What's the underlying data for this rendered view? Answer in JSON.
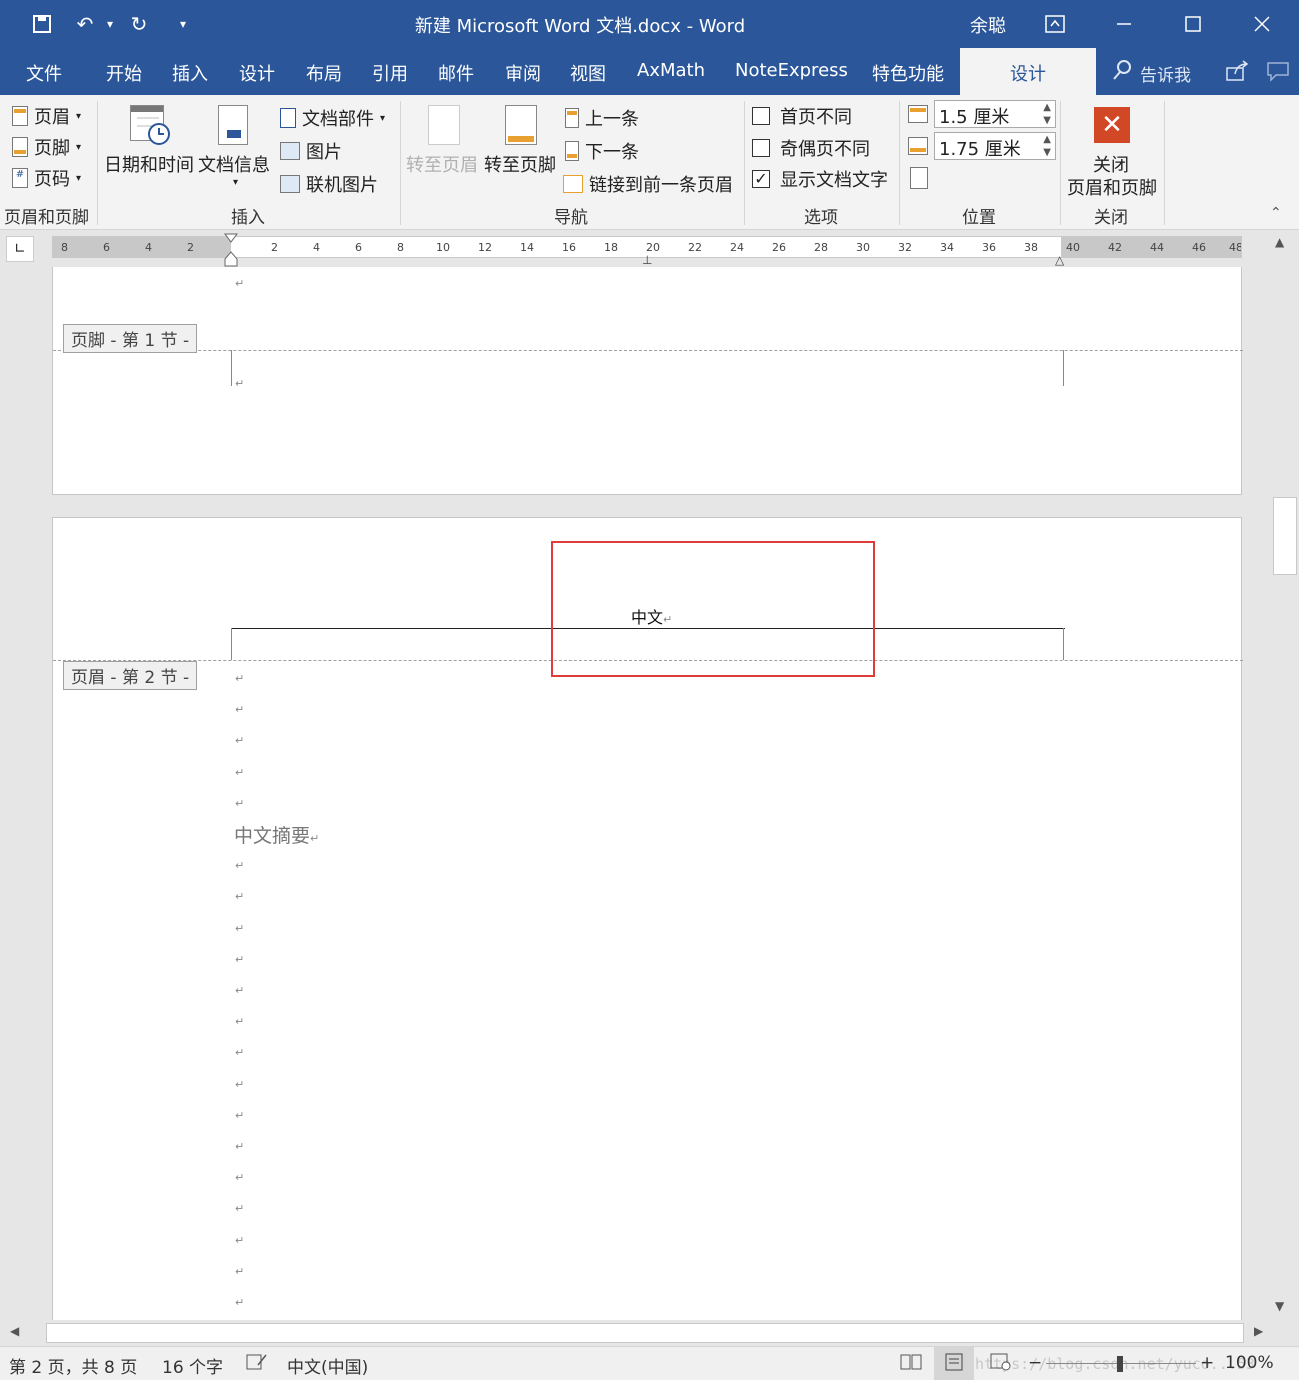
{
  "titlebar": {
    "title": "新建 Microsoft Word 文档.docx  -  Word",
    "user": "余聪",
    "qa_icons": [
      "save-icon",
      "undo-icon",
      "redo-icon",
      "customize-icon"
    ]
  },
  "tabs": {
    "items": [
      "文件",
      "开始",
      "插入",
      "设计",
      "布局",
      "引用",
      "邮件",
      "审阅",
      "视图",
      "AxMath",
      "NoteExpress",
      "特色功能"
    ],
    "active": "设计",
    "tell_me": "告诉我"
  },
  "ribbon": {
    "hf_group": {
      "header": "页眉",
      "footer": "页脚",
      "page_number": "页码",
      "label": "页眉和页脚"
    },
    "insert_group": {
      "datetime": "日期和时间",
      "docinfo": "文档信息",
      "quickparts": "文档部件",
      "picture": "图片",
      "online_picture": "联机图片",
      "label": "插入"
    },
    "nav_group": {
      "goto_header": "转至页眉",
      "goto_footer": "转至页脚",
      "previous": "上一条",
      "next": "下一条",
      "link_previous": "链接到前一条页眉",
      "label": "导航"
    },
    "options_group": {
      "diff_first": "首页不同",
      "diff_odd_even": "奇偶页不同",
      "show_doc_text": "显示文档文字",
      "label": "选项"
    },
    "position_group": {
      "header_from_top": "1.5 厘米",
      "footer_from_bottom": "1.75 厘米",
      "label": "位置"
    },
    "close_group": {
      "close_line1": "关闭",
      "close_line2": "页眉和页脚",
      "label": "关闭"
    }
  },
  "ruler": {
    "left_ticks": [
      "8",
      "6",
      "4",
      "2"
    ],
    "right_ticks": [
      "2",
      "4",
      "6",
      "8",
      "10",
      "12",
      "14",
      "16",
      "18",
      "20",
      "22",
      "24",
      "26",
      "28",
      "30",
      "32",
      "34",
      "36",
      "38",
      "40",
      "42",
      "44",
      "46",
      "48"
    ]
  },
  "page1": {
    "footer_label": "页脚 - 第 1 节 -"
  },
  "page2": {
    "header_label": "页眉 - 第 2 节 -",
    "header_text": "中文",
    "abstract_heading": "中文摘要"
  },
  "statusbar": {
    "page_info": "第 2 页，共 8 页",
    "word_count": "16 个字",
    "language": "中文(中国)",
    "zoom": "100%",
    "watermark": "https://blog.csdn.net/yuco...53"
  },
  "colors": {
    "accent": "#2b579a",
    "highlight_box": "#e03c3c",
    "close_button": "#d24726"
  }
}
